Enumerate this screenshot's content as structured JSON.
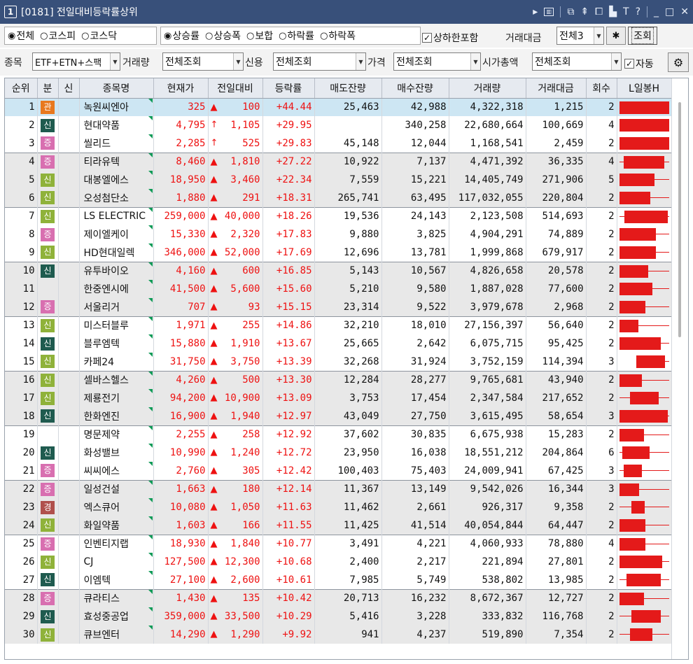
{
  "window": {
    "number": "1",
    "title": "[0181] 전일대비등락률상위",
    "icons": [
      "play-icon",
      "screen-icon",
      "pin-icon",
      "upload-icon",
      "window-icon",
      "font-icon",
      "text-size-icon",
      "help-icon",
      "minimize-icon",
      "maximize-icon",
      "close-icon"
    ]
  },
  "toolbar": {
    "market_options": [
      "전체",
      "코스피",
      "코스닥"
    ],
    "market_selected": 0,
    "sort_options": [
      "상승률",
      "상승폭",
      "보합",
      "하락률",
      "하락폭"
    ],
    "sort_selected": 0,
    "include_limit_label": "상하한포함",
    "include_limit_checked": true,
    "trade_amount_label": "거래대금",
    "trade_amount_value": "전체3",
    "search_button": "조회",
    "item_label": "종목",
    "item_value": "ETF+ETN+스팩",
    "volume_label": "거래량",
    "volume_value": "전체조회",
    "credit_label": "신용",
    "credit_value": "전체조회",
    "price_label": "가격",
    "price_value": "전체조회",
    "marketcap_label": "시가총액",
    "marketcap_value": "전체조회",
    "auto_label": "자동",
    "auto_checked": true
  },
  "columns": [
    "순위",
    "분",
    "신",
    "종목명",
    "현재가",
    "전일대비",
    "등락률",
    "매도잔량",
    "매수잔량",
    "거래량",
    "거래대금",
    "회수",
    "L일봉H"
  ],
  "badge_colors": {
    "관": "#e8781e",
    "신": "#1f5b4f",
    "증": "#d86fb0",
    "신2": "#8fb23a",
    "경": "#b0504c"
  },
  "rows": [
    {
      "rank": "1",
      "b": "관",
      "bc": "관",
      "name": "녹원씨엔아",
      "price": "325",
      "arrow": "▲",
      "chg": "100",
      "rate": "+44.44",
      "sell": "25,463",
      "buy": "42,988",
      "vol": "4,322,318",
      "amt": "1,215",
      "cnt": "2",
      "candle": [
        0.02,
        0.02,
        0.98,
        0.98
      ]
    },
    {
      "rank": "2",
      "b": "신",
      "bc": "신",
      "name": "현대약품",
      "price": "4,795",
      "arrow": "↑",
      "chg": "1,105",
      "rate": "+29.95",
      "sell": "",
      "buy": "340,258",
      "vol": "22,680,664",
      "amt": "100,669",
      "cnt": "4",
      "candle": [
        0.02,
        0.02,
        0.98,
        0.98
      ]
    },
    {
      "rank": "3",
      "b": "증",
      "bc": "증",
      "name": "씰리드",
      "price": "2,285",
      "arrow": "↑",
      "chg": "525",
      "rate": "+29.83",
      "sell": "45,148",
      "buy": "12,044",
      "vol": "1,168,541",
      "amt": "2,459",
      "cnt": "2",
      "candle": [
        0.02,
        0.02,
        0.98,
        0.98
      ]
    },
    {
      "rank": "4",
      "b": "증",
      "bc": "증",
      "name": "티라유텍",
      "price": "8,460",
      "arrow": "▲",
      "chg": "1,810",
      "rate": "+27.22",
      "sell": "10,922",
      "buy": "7,137",
      "vol": "4,471,392",
      "amt": "36,335",
      "cnt": "4",
      "candle": [
        0.02,
        0.1,
        0.88,
        0.98
      ]
    },
    {
      "rank": "5",
      "b": "신",
      "bc": "신2",
      "name": "대봉엘에스",
      "price": "18,950",
      "arrow": "▲",
      "chg": "3,460",
      "rate": "+22.34",
      "sell": "7,559",
      "buy": "15,221",
      "vol": "14,405,749",
      "amt": "271,906",
      "cnt": "5",
      "candle": [
        0.02,
        0.02,
        0.7,
        0.98
      ]
    },
    {
      "rank": "6",
      "b": "신",
      "bc": "신2",
      "name": "오성첨단소",
      "price": "1,880",
      "arrow": "▲",
      "chg": "291",
      "rate": "+18.31",
      "sell": "265,741",
      "buy": "63,495",
      "vol": "117,032,055",
      "amt": "220,804",
      "cnt": "2",
      "candle": [
        0.02,
        0.02,
        0.62,
        0.98
      ]
    },
    {
      "rank": "7",
      "b": "신",
      "bc": "신2",
      "name": "LS ELECTRIC",
      "price": "259,000",
      "arrow": "▲",
      "chg": "40,000",
      "rate": "+18.26",
      "sell": "19,536",
      "buy": "24,143",
      "vol": "2,123,508",
      "amt": "514,693",
      "cnt": "2",
      "candle": [
        0.02,
        0.12,
        0.95,
        0.98
      ]
    },
    {
      "rank": "8",
      "b": "증",
      "bc": "증",
      "name": "제이엘케이",
      "price": "15,330",
      "arrow": "▲",
      "chg": "2,320",
      "rate": "+17.83",
      "sell": "9,880",
      "buy": "3,825",
      "vol": "4,904,291",
      "amt": "74,889",
      "cnt": "2",
      "candle": [
        0.02,
        0.02,
        0.72,
        0.98
      ]
    },
    {
      "rank": "9",
      "b": "신",
      "bc": "신2",
      "name": "HD현대일렉",
      "price": "346,000",
      "arrow": "▲",
      "chg": "52,000",
      "rate": "+17.69",
      "sell": "12,696",
      "buy": "13,781",
      "vol": "1,999,868",
      "amt": "679,917",
      "cnt": "2",
      "candle": [
        0.02,
        0.02,
        0.72,
        0.98
      ]
    },
    {
      "rank": "10",
      "b": "신",
      "bc": "신",
      "name": "유투바이오",
      "price": "4,160",
      "arrow": "▲",
      "chg": "600",
      "rate": "+16.85",
      "sell": "5,143",
      "buy": "10,567",
      "vol": "4,826,658",
      "amt": "20,578",
      "cnt": "2",
      "candle": [
        0.02,
        0.02,
        0.58,
        0.98
      ]
    },
    {
      "rank": "11",
      "b": "",
      "bc": "",
      "name": "한중엔시에",
      "price": "41,500",
      "arrow": "▲",
      "chg": "5,600",
      "rate": "+15.60",
      "sell": "5,210",
      "buy": "9,580",
      "vol": "1,887,028",
      "amt": "77,600",
      "cnt": "2",
      "candle": [
        0.02,
        0.02,
        0.65,
        0.98
      ]
    },
    {
      "rank": "12",
      "b": "증",
      "bc": "증",
      "name": "서울리거",
      "price": "707",
      "arrow": "▲",
      "chg": "93",
      "rate": "+15.15",
      "sell": "23,314",
      "buy": "9,522",
      "vol": "3,979,678",
      "amt": "2,968",
      "cnt": "2",
      "candle": [
        0.02,
        0.02,
        0.52,
        0.98
      ]
    },
    {
      "rank": "13",
      "b": "신",
      "bc": "신2",
      "name": "미스터블루",
      "price": "1,971",
      "arrow": "▲",
      "chg": "255",
      "rate": "+14.86",
      "sell": "32,210",
      "buy": "18,010",
      "vol": "27,156,397",
      "amt": "56,640",
      "cnt": "2",
      "candle": [
        0.02,
        0.02,
        0.38,
        0.98
      ]
    },
    {
      "rank": "14",
      "b": "신",
      "bc": "신",
      "name": "블루엠텍",
      "price": "15,880",
      "arrow": "▲",
      "chg": "1,910",
      "rate": "+13.67",
      "sell": "25,665",
      "buy": "2,642",
      "vol": "6,075,715",
      "amt": "95,425",
      "cnt": "2",
      "candle": [
        0.02,
        0.02,
        0.82,
        0.98
      ]
    },
    {
      "rank": "15",
      "b": "신",
      "bc": "신2",
      "name": "카페24",
      "price": "31,750",
      "arrow": "▲",
      "chg": "3,750",
      "rate": "+13.39",
      "sell": "32,268",
      "buy": "31,924",
      "vol": "3,752,159",
      "amt": "114,394",
      "cnt": "3",
      "candle": [
        0.35,
        0.35,
        0.9,
        0.98
      ]
    },
    {
      "rank": "16",
      "b": "신",
      "bc": "신2",
      "name": "셀바스헬스",
      "price": "4,260",
      "arrow": "▲",
      "chg": "500",
      "rate": "+13.30",
      "sell": "12,284",
      "buy": "28,277",
      "vol": "9,765,681",
      "amt": "43,940",
      "cnt": "2",
      "candle": [
        0.02,
        0.02,
        0.45,
        0.98
      ]
    },
    {
      "rank": "17",
      "b": "신",
      "bc": "신2",
      "name": "제룡전기",
      "price": "94,200",
      "arrow": "▲",
      "chg": "10,900",
      "rate": "+13.09",
      "sell": "3,753",
      "buy": "17,454",
      "vol": "2,347,584",
      "amt": "217,652",
      "cnt": "2",
      "candle": [
        0.02,
        0.22,
        0.78,
        0.98
      ]
    },
    {
      "rank": "18",
      "b": "신",
      "bc": "신",
      "name": "한화엔진",
      "price": "16,900",
      "arrow": "▲",
      "chg": "1,940",
      "rate": "+12.97",
      "sell": "43,049",
      "buy": "27,750",
      "vol": "3,615,495",
      "amt": "58,654",
      "cnt": "3",
      "candle": [
        0.02,
        0.02,
        0.95,
        0.98
      ]
    },
    {
      "rank": "19",
      "b": "",
      "bc": "",
      "name": "명문제약",
      "price": "2,255",
      "arrow": "▲",
      "chg": "258",
      "rate": "+12.92",
      "sell": "37,602",
      "buy": "30,835",
      "vol": "6,675,938",
      "amt": "15,283",
      "cnt": "2",
      "candle": [
        0.02,
        0.02,
        0.5,
        0.98
      ]
    },
    {
      "rank": "20",
      "b": "신",
      "bc": "신",
      "name": "화성밸브",
      "price": "10,990",
      "arrow": "▲",
      "chg": "1,240",
      "rate": "+12.72",
      "sell": "23,950",
      "buy": "16,038",
      "vol": "18,551,212",
      "amt": "204,864",
      "cnt": "6",
      "candle": [
        0.02,
        0.08,
        0.6,
        0.98
      ]
    },
    {
      "rank": "21",
      "b": "증",
      "bc": "증",
      "name": "씨씨에스",
      "price": "2,760",
      "arrow": "▲",
      "chg": "305",
      "rate": "+12.42",
      "sell": "100,403",
      "buy": "75,403",
      "vol": "24,009,941",
      "amt": "67,425",
      "cnt": "3",
      "candle": [
        0.02,
        0.1,
        0.45,
        0.98
      ]
    },
    {
      "rank": "22",
      "b": "증",
      "bc": "증",
      "name": "일성건설",
      "price": "1,663",
      "arrow": "▲",
      "chg": "180",
      "rate": "+12.14",
      "sell": "11,367",
      "buy": "13,149",
      "vol": "9,542,026",
      "amt": "16,344",
      "cnt": "3",
      "candle": [
        0.02,
        0.02,
        0.4,
        0.98
      ]
    },
    {
      "rank": "23",
      "b": "경",
      "bc": "경",
      "name": "엑스큐어",
      "price": "10,080",
      "arrow": "▲",
      "chg": "1,050",
      "rate": "+11.63",
      "sell": "11,462",
      "buy": "2,661",
      "vol": "926,317",
      "amt": "9,358",
      "cnt": "2",
      "candle": [
        0.02,
        0.25,
        0.5,
        0.98
      ]
    },
    {
      "rank": "24",
      "b": "신",
      "bc": "신2",
      "name": "화일약품",
      "price": "1,603",
      "arrow": "▲",
      "chg": "166",
      "rate": "+11.55",
      "sell": "11,425",
      "buy": "41,514",
      "vol": "40,054,844",
      "amt": "64,447",
      "cnt": "2",
      "candle": [
        0.02,
        0.02,
        0.52,
        0.98
      ]
    },
    {
      "rank": "25",
      "b": "증",
      "bc": "증",
      "name": "인벤티지랩",
      "price": "18,930",
      "arrow": "▲",
      "chg": "1,840",
      "rate": "+10.77",
      "sell": "3,491",
      "buy": "4,221",
      "vol": "4,060,933",
      "amt": "78,880",
      "cnt": "4",
      "candle": [
        0.02,
        0.02,
        0.52,
        0.98
      ]
    },
    {
      "rank": "26",
      "b": "신",
      "bc": "신2",
      "name": "CJ",
      "price": "127,500",
      "arrow": "▲",
      "chg": "12,300",
      "rate": "+10.68",
      "sell": "2,400",
      "buy": "2,217",
      "vol": "221,894",
      "amt": "27,801",
      "cnt": "2",
      "candle": [
        0.02,
        0.02,
        0.85,
        0.98
      ]
    },
    {
      "rank": "27",
      "b": "신",
      "bc": "신",
      "name": "이엠텍",
      "price": "27,100",
      "arrow": "▲",
      "chg": "2,600",
      "rate": "+10.61",
      "sell": "7,985",
      "buy": "5,749",
      "vol": "538,802",
      "amt": "13,985",
      "cnt": "2",
      "candle": [
        0.02,
        0.15,
        0.82,
        0.98
      ]
    },
    {
      "rank": "28",
      "b": "증",
      "bc": "증",
      "name": "큐라티스",
      "price": "1,430",
      "arrow": "▲",
      "chg": "135",
      "rate": "+10.42",
      "sell": "20,713",
      "buy": "16,232",
      "vol": "8,672,367",
      "amt": "12,727",
      "cnt": "2",
      "candle": [
        0.02,
        0.02,
        0.5,
        0.98
      ]
    },
    {
      "rank": "29",
      "b": "신",
      "bc": "신",
      "name": "효성중공업",
      "price": "359,000",
      "arrow": "▲",
      "chg": "33,500",
      "rate": "+10.29",
      "sell": "5,416",
      "buy": "3,228",
      "vol": "333,832",
      "amt": "116,768",
      "cnt": "2",
      "candle": [
        0.02,
        0.25,
        0.82,
        0.98
      ]
    },
    {
      "rank": "30",
      "b": "신",
      "bc": "신2",
      "name": "큐브엔터",
      "price": "14,290",
      "arrow": "▲",
      "chg": "1,290",
      "rate": "+9.92",
      "sell": "941",
      "buy": "4,237",
      "vol": "519,890",
      "amt": "7,354",
      "cnt": "2",
      "candle": [
        0.02,
        0.22,
        0.65,
        0.98
      ]
    }
  ],
  "row_groups": {
    "selected": [
      0
    ],
    "shaded": [
      3,
      4,
      5,
      9,
      10,
      11,
      15,
      16,
      17,
      21,
      22,
      23,
      27,
      28,
      29
    ],
    "group_starts": [
      3,
      6,
      9,
      12,
      15,
      18,
      21,
      24,
      27
    ]
  }
}
